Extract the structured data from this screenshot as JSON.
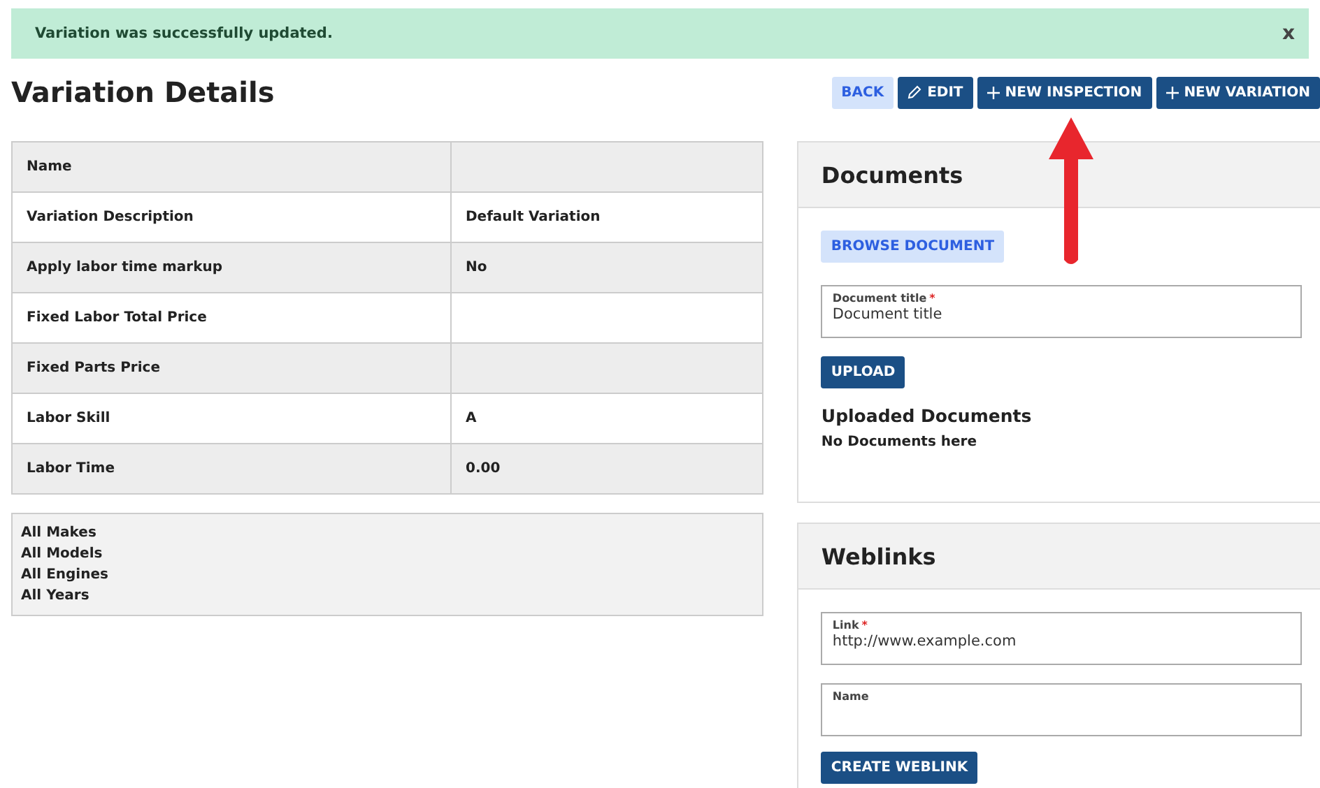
{
  "alert": {
    "message": "Variation was successfully updated.",
    "close": "x"
  },
  "page_title": "Variation Details",
  "actions": [
    {
      "label": "BACK",
      "kind": "back"
    },
    {
      "label": "EDIT",
      "kind": "edit"
    },
    {
      "label": "NEW INSPECTION",
      "kind": "add"
    },
    {
      "label": "NEW VARIATION",
      "kind": "add"
    }
  ],
  "details": [
    {
      "label": "Name"
    },
    {
      "label": "Variation Description",
      "value": "Default Variation"
    },
    {
      "label": "Apply labor time markup",
      "value": "No"
    },
    {
      "label": "Fixed Labor Total Price"
    },
    {
      "label": "Fixed Parts Price"
    },
    {
      "label": "Labor Skill",
      "value": "A"
    },
    {
      "label": "Labor Time",
      "value": "0.00"
    }
  ],
  "applicability": [
    "All Makes",
    "All Models",
    "All Engines",
    "All Years"
  ],
  "documents": {
    "title": "Documents",
    "browse_button": "BROWSE DOCUMENT",
    "field": {
      "label": "Document title",
      "required_mark": "*",
      "placeholder": "Document title"
    },
    "upload_button": "UPLOAD",
    "uploaded_heading": "Uploaded Documents",
    "empty_text": "No Documents here"
  },
  "weblinks": {
    "title": "Weblinks",
    "fields": [
      {
        "label": "Link",
        "required_mark": "*",
        "placeholder": "http://www.example.com"
      },
      {
        "label": "Name"
      }
    ],
    "create_button": "CREATE WEBLINK"
  }
}
